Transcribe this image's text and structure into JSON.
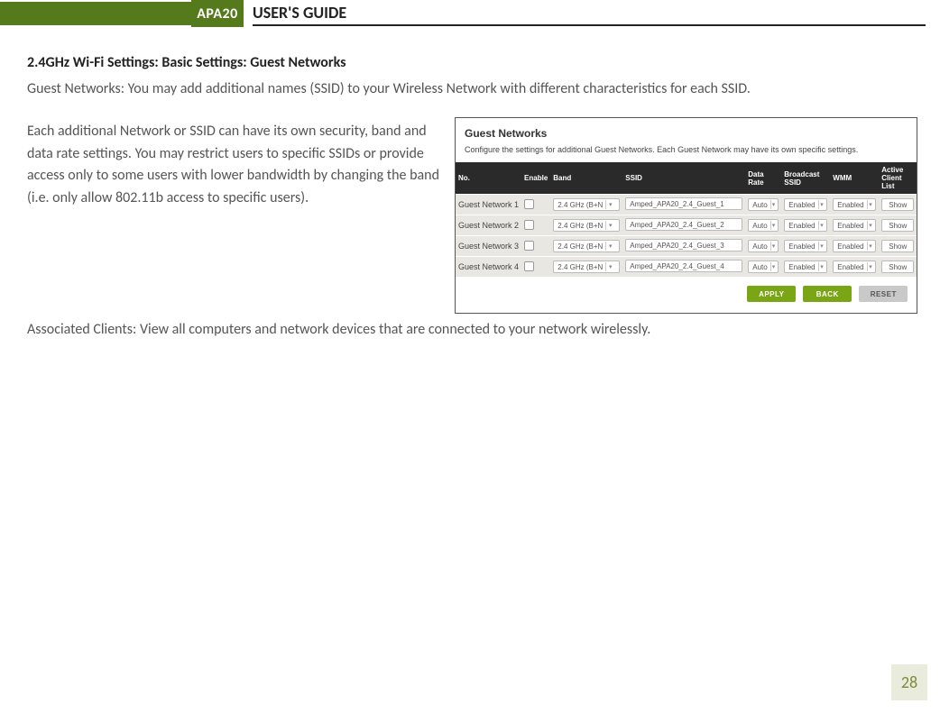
{
  "header": {
    "tag": "APA20",
    "title": "USER'S GUIDE"
  },
  "section_title": "2.4GHz Wi-Fi Settings: Basic Settings: Guest Networks",
  "intro": "Guest Networks: You may add additional names (SSID) to your Wireless Network with different characteristics for each SSID.",
  "para2": "Each additional Network or SSID can have its own security, band and data rate settings. You may restrict users to specific SSIDs or provide access only to some users with lower bandwidth by changing the band (i.e. only allow 802.11b access to specific users).",
  "para3": "Associated Clients: View all computers and network devices that are connected to your network wirelessly.",
  "panel": {
    "title": "Guest Networks",
    "desc": "Configure the settings for additional Guest Networks. Each Guest Network may have its own specific settings.",
    "cols": {
      "no": "No.",
      "enable": "Enable",
      "band": "Band",
      "ssid": "SSID",
      "rate": "Data Rate",
      "bc": "Broadcast SSID",
      "wmm": "WMM",
      "acl": "Active Client List"
    },
    "rows": [
      {
        "no": "Guest Network 1",
        "band": "2.4 GHz (B+N",
        "ssid": "Amped_APA20_2.4_Guest_1",
        "rate": "Auto",
        "bc": "Enabled",
        "wmm": "Enabled",
        "show": "Show"
      },
      {
        "no": "Guest Network 2",
        "band": "2.4 GHz (B+N",
        "ssid": "Amped_APA20_2.4_Guest_2",
        "rate": "Auto",
        "bc": "Enabled",
        "wmm": "Enabled",
        "show": "Show"
      },
      {
        "no": "Guest Network 3",
        "band": "2.4 GHz (B+N",
        "ssid": "Amped_APA20_2.4_Guest_3",
        "rate": "Auto",
        "bc": "Enabled",
        "wmm": "Enabled",
        "show": "Show"
      },
      {
        "no": "Guest Network 4",
        "band": "2.4 GHz (B+N",
        "ssid": "Amped_APA20_2.4_Guest_4",
        "rate": "Auto",
        "bc": "Enabled",
        "wmm": "Enabled",
        "show": "Show"
      }
    ],
    "buttons": {
      "apply": "APPLY",
      "back": "BACK",
      "reset": "RESET"
    }
  },
  "page_number": "28"
}
